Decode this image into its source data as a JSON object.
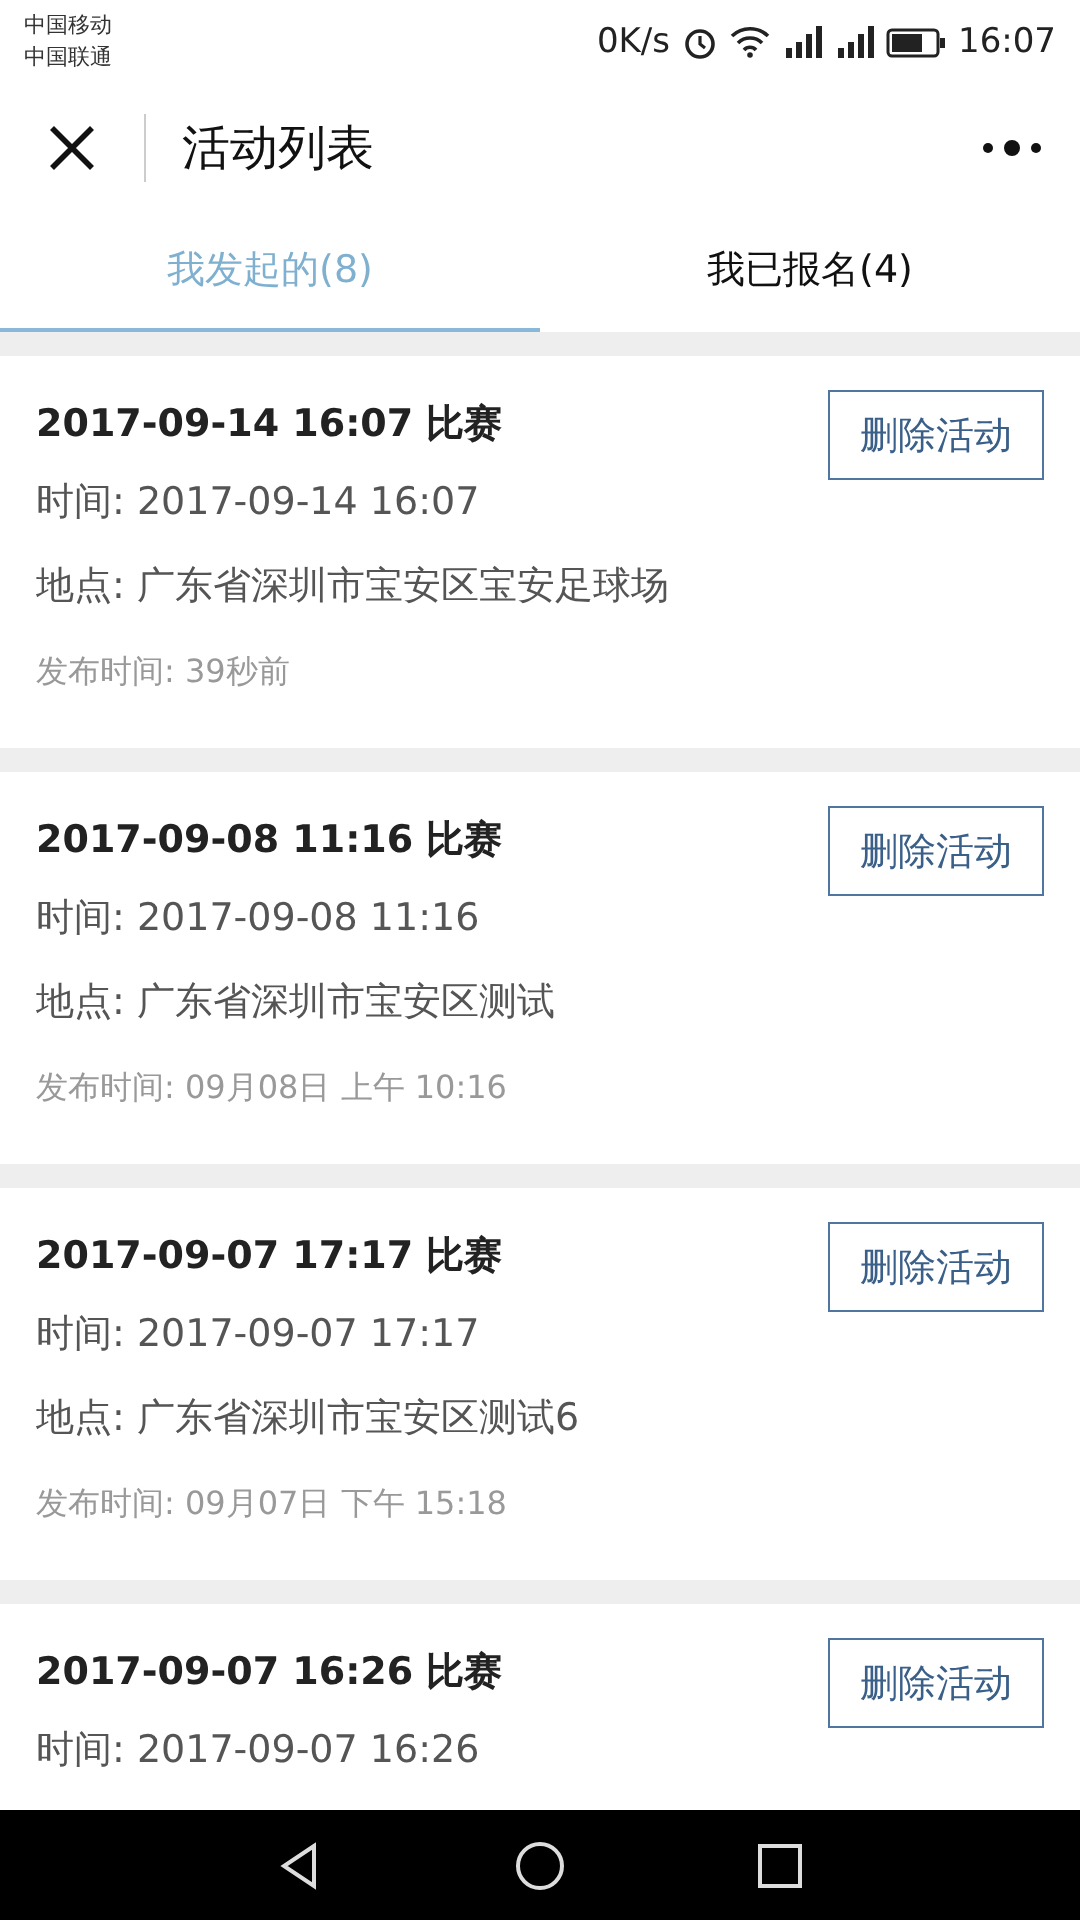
{
  "status_bar": {
    "carriers": [
      "中国移动",
      "中国联通"
    ],
    "speed": "0K/s",
    "time": "16:07"
  },
  "header": {
    "title": "活动列表"
  },
  "tabs": [
    {
      "label": "我发起的(8)",
      "selected": true
    },
    {
      "label": "我已报名(4)",
      "selected": false
    }
  ],
  "activities": [
    {
      "title": "2017-09-14 16:07 比赛",
      "time": "时间: 2017-09-14 16:07",
      "place": "地点: 广东省深圳市宝安区宝安足球场",
      "published": "发布时间: 39秒前",
      "button": "删除活动"
    },
    {
      "title": "2017-09-08 11:16 比赛",
      "time": "时间: 2017-09-08 11:16",
      "place": "地点: 广东省深圳市宝安区测试",
      "published": "发布时间: 09月08日 上午 10:16",
      "button": "删除活动"
    },
    {
      "title": "2017-09-07 17:17 比赛",
      "time": "时间: 2017-09-07 17:17",
      "place": "地点: 广东省深圳市宝安区测试6",
      "published": "发布时间: 09月07日 下午 15:18",
      "button": "删除活动"
    },
    {
      "title": "2017-09-07 16:26 比赛",
      "time": "时间: 2017-09-07 16:26",
      "button": "删除活动"
    }
  ]
}
